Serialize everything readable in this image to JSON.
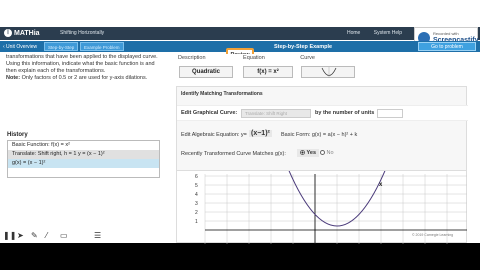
{
  "app": {
    "logo": "MATHia",
    "title": "Shifting Horizontally",
    "links": [
      "Home",
      "System Help"
    ]
  },
  "recorder": {
    "tagline": "Recorded with",
    "brand": "Screencastify"
  },
  "nav": {
    "unit_overview": "‹ Unit Overview",
    "tabs": [
      "Step-by-Step",
      "Example Problem"
    ],
    "step_title": "Step-by-Step Example",
    "next_button": "Go to problem"
  },
  "review_button": "Review",
  "intro": {
    "text": "transformations that have been applied to the displayed curve. Using this information, indicate what the basic function is and then explain each of the transformations.",
    "note_label": "Note:",
    "note_text": " Only factors of 0.5 or 2 are used for y-axis dilations."
  },
  "history": {
    "title": "History",
    "rows": [
      "Basic Function: f(x) = x²",
      "Translate: Shift right, h = 1  y = (x − 1)²",
      "g(x) = (x − 1)²"
    ]
  },
  "columns": {
    "headers": [
      "Description",
      "Equation",
      "Curve"
    ],
    "description": "Quadratic",
    "equation": "f(x) = x²"
  },
  "identify": {
    "section_title": "Identify Matching Transformations",
    "edit_label": "Edit Graphical Curve:",
    "dropdown_value": "Translate: Shift Right",
    "by_units": "by the number of units",
    "algebraic_label": "Edit Algebraic Equation: y=",
    "algebraic_eq": "(x−1)²",
    "basic_form": "Basic Form: g(x) = a(x − h)² + k",
    "matches_label": "Recently Transformed Curve Matches g(x):",
    "yes": "Yes",
    "no": "No"
  },
  "graph": {
    "y_ticks": [
      "6",
      "5",
      "4",
      "3",
      "2",
      "1"
    ],
    "curve_label": "x",
    "colors": {
      "curve": "#4a3a7a",
      "grid": "#c8c8c8",
      "axis": "#000000"
    }
  },
  "footer": {
    "copyright": "© 2019 Carnegie Learning"
  },
  "tool_icons": [
    "pause-icon",
    "cursor-icon",
    "pen-icon",
    "line-icon",
    "camera-icon",
    "menu-icon"
  ]
}
